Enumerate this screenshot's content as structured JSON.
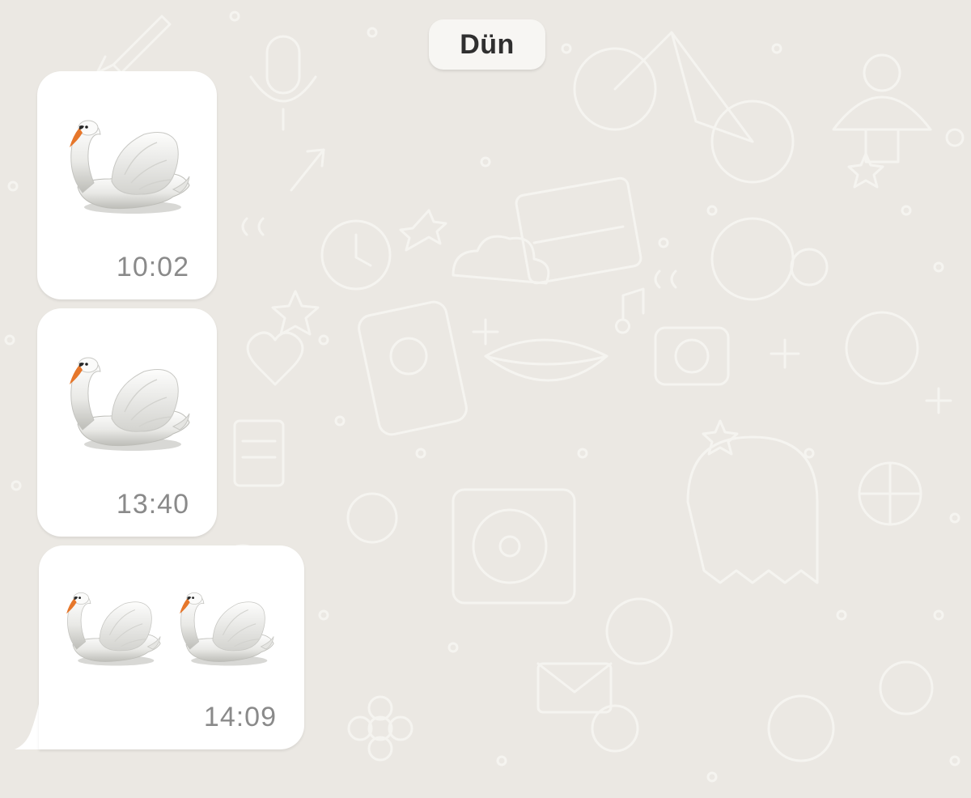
{
  "chat": {
    "date_separator": "Dün",
    "messages": [
      {
        "emoji": [
          "swan-emoji"
        ],
        "time": "10:02"
      },
      {
        "emoji": [
          "swan-emoji"
        ],
        "time": "13:40"
      },
      {
        "emoji": [
          "swan-emoji",
          "swan-emoji"
        ],
        "time": "14:09"
      }
    ]
  },
  "colors": {
    "wallpaper": "#ebe8e3",
    "bubble": "#ffffff",
    "timestamp": "#8a8a8a"
  }
}
